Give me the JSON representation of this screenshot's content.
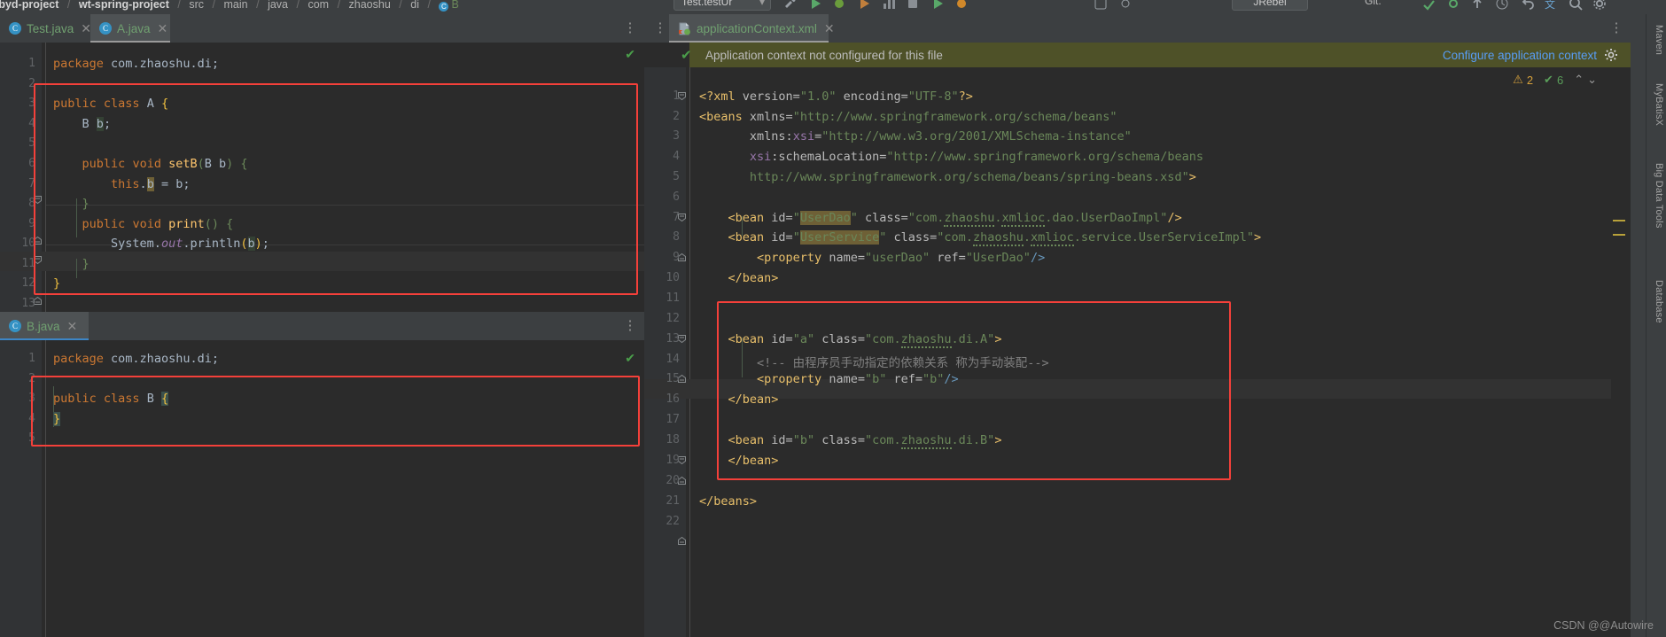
{
  "window": {
    "breadcrumb": [
      "t-byd-project",
      "wt-spring-project",
      "src",
      "main",
      "java",
      "com",
      "zhaoshu",
      "di",
      "B"
    ],
    "run_config": "Test.testUr",
    "jrebel_label": "JRebel",
    "git_label": "Git:"
  },
  "left_panel": {
    "tabs": [
      {
        "label": "Test.java",
        "icon": "java-class-icon",
        "active": false
      },
      {
        "label": "A.java",
        "icon": "java-class-icon",
        "active": true
      }
    ],
    "tab_menu_icon": "more-vertical-icon",
    "status_icon": "check-icon",
    "file_a": {
      "name": "A.java",
      "lines": [
        {
          "n": "1",
          "text": "package com.zhaoshu.di;"
        },
        {
          "n": "2",
          "text": ""
        },
        {
          "n": "3",
          "text": "public class A {"
        },
        {
          "n": "4",
          "text": "    B b;"
        },
        {
          "n": "5",
          "text": ""
        },
        {
          "n": "6",
          "text": "    public void setB(B b) {"
        },
        {
          "n": "7",
          "text": "        this.b = b;"
        },
        {
          "n": "8",
          "text": "    }"
        },
        {
          "n": "9",
          "text": "    public void print() {"
        },
        {
          "n": "10",
          "text": "        System.out.println(b);"
        },
        {
          "n": "11",
          "text": "    }"
        },
        {
          "n": "12",
          "text": "}"
        },
        {
          "n": "13",
          "text": ""
        }
      ]
    },
    "tab_b": {
      "label": "B.java",
      "icon": "java-class-icon",
      "active": true
    },
    "file_b": {
      "name": "B.java",
      "status_icon": "check-icon",
      "tab_menu_icon": "more-vertical-icon",
      "lines": [
        {
          "n": "1",
          "text": "package com.zhaoshu.di;"
        },
        {
          "n": "2",
          "text": ""
        },
        {
          "n": "3",
          "text": "public class B {"
        },
        {
          "n": "4",
          "text": "}"
        },
        {
          "n": "5",
          "text": ""
        }
      ]
    }
  },
  "right_panel": {
    "tab": {
      "label": "applicationContext.xml",
      "icon": "spring-xml-icon"
    },
    "tab_menu_icon": "more-vertical-icon",
    "notification": {
      "check_icon": "check-icon",
      "message": "Application context not configured for this file",
      "link": "Configure application context",
      "gear_icon": "gear-icon"
    },
    "inspections": {
      "warning_icon": "warning-triangle-icon",
      "warning_count": "2",
      "ok_icon": "check-icon",
      "ok_count": "6",
      "up_icon": "chevron-up-icon",
      "down_icon": "chevron-down-icon"
    },
    "file_xml": {
      "name": "applicationContext.xml",
      "lines": [
        {
          "n": "1",
          "text": "<?xml version=\"1.0\" encoding=\"UTF-8\"?>"
        },
        {
          "n": "2",
          "text": "<beans xmlns=\"http://www.springframework.org/schema/beans\""
        },
        {
          "n": "3",
          "text": "       xmlns:xsi=\"http://www.w3.org/2001/XMLSchema-instance\""
        },
        {
          "n": "4",
          "text": "       xsi:schemaLocation=\"http://www.springframework.org/schema/beans"
        },
        {
          "n": "5",
          "text": "       http://www.springframework.org/schema/beans/spring-beans.xsd\">"
        },
        {
          "n": "6",
          "text": ""
        },
        {
          "n": "7",
          "text": "    <bean id=\"UserDao\" class=\"com.zhaoshu.xmlioc.dao.UserDaoImpl\"/>"
        },
        {
          "n": "8",
          "text": "    <bean id=\"UserService\" class=\"com.zhaoshu.xmlioc.service.UserServiceImpl\">"
        },
        {
          "n": "9",
          "text": "        <property name=\"userDao\" ref=\"UserDao\"/>"
        },
        {
          "n": "10",
          "text": "    </bean>"
        },
        {
          "n": "11",
          "text": ""
        },
        {
          "n": "12",
          "text": ""
        },
        {
          "n": "13",
          "text": "    <bean id=\"a\" class=\"com.zhaoshu.di.A\">"
        },
        {
          "n": "14",
          "text": "        <!-- 由程序员手动指定的依赖关系 称为手动装配-->"
        },
        {
          "n": "15",
          "text": "        <property name=\"b\" ref=\"b\"/>"
        },
        {
          "n": "16",
          "text": "    </bean>"
        },
        {
          "n": "17",
          "text": ""
        },
        {
          "n": "18",
          "text": "    <bean id=\"b\" class=\"com.zhaoshu.di.B\">"
        },
        {
          "n": "19",
          "text": "    </bean>"
        },
        {
          "n": "20",
          "text": ""
        },
        {
          "n": "21",
          "text": "</beans>"
        },
        {
          "n": "22",
          "text": ""
        }
      ]
    }
  },
  "right_rail": [
    "Maven",
    "MyBatisX",
    "Big Data Tools",
    "Database"
  ],
  "watermark": "CSDN @@Autowire",
  "colors": {
    "annotation_red": "#f4403a",
    "notification_bg": "#4e5128",
    "link_blue": "#589df6",
    "editor_bg": "#2b2b2b",
    "gutter_bg": "#313335",
    "chrome_bg": "#3c3f41"
  }
}
